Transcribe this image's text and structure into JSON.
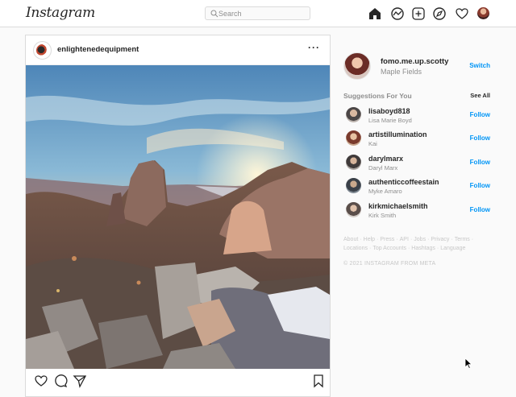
{
  "header": {
    "logo": "Instagram",
    "search_placeholder": "Search",
    "nav_icons": [
      "home-icon",
      "explore-icon",
      "new-post-icon",
      "compass-icon",
      "heart-icon",
      "profile-avatar"
    ]
  },
  "post": {
    "username": "enlightenedequipment",
    "more": "···",
    "actions": [
      "heart-icon",
      "comment-icon",
      "share-icon",
      "bookmark-icon"
    ]
  },
  "sidebar": {
    "me": {
      "username": "fomo.me.up.scotty",
      "name": "Maple Fields",
      "switch_label": "Switch"
    },
    "suggestions_title": "Suggestions For You",
    "see_all": "See All",
    "suggestions": [
      {
        "username": "lisaboyd818",
        "name": "Lisa Marie Boyd",
        "follow": "Follow"
      },
      {
        "username": "artistillumination",
        "name": "Kai",
        "follow": "Follow"
      },
      {
        "username": "darylmarx",
        "name": "Daryl Marx",
        "follow": "Follow"
      },
      {
        "username": "authenticcoffeestain",
        "name": "Myke Amaro",
        "follow": "Follow"
      },
      {
        "username": "kirkmichaelsmith",
        "name": "Kirk Smith",
        "follow": "Follow"
      }
    ],
    "footer_links": [
      "About",
      "Help",
      "Press",
      "API",
      "Jobs",
      "Privacy",
      "Terms",
      "Locations",
      "Top Accounts",
      "Hashtags",
      "Language"
    ],
    "copyright": "© 2021 INSTAGRAM FROM META"
  },
  "colors": {
    "link_blue": "#0095f6",
    "border": "#dbdbdb",
    "muted": "#8e8e8e"
  }
}
